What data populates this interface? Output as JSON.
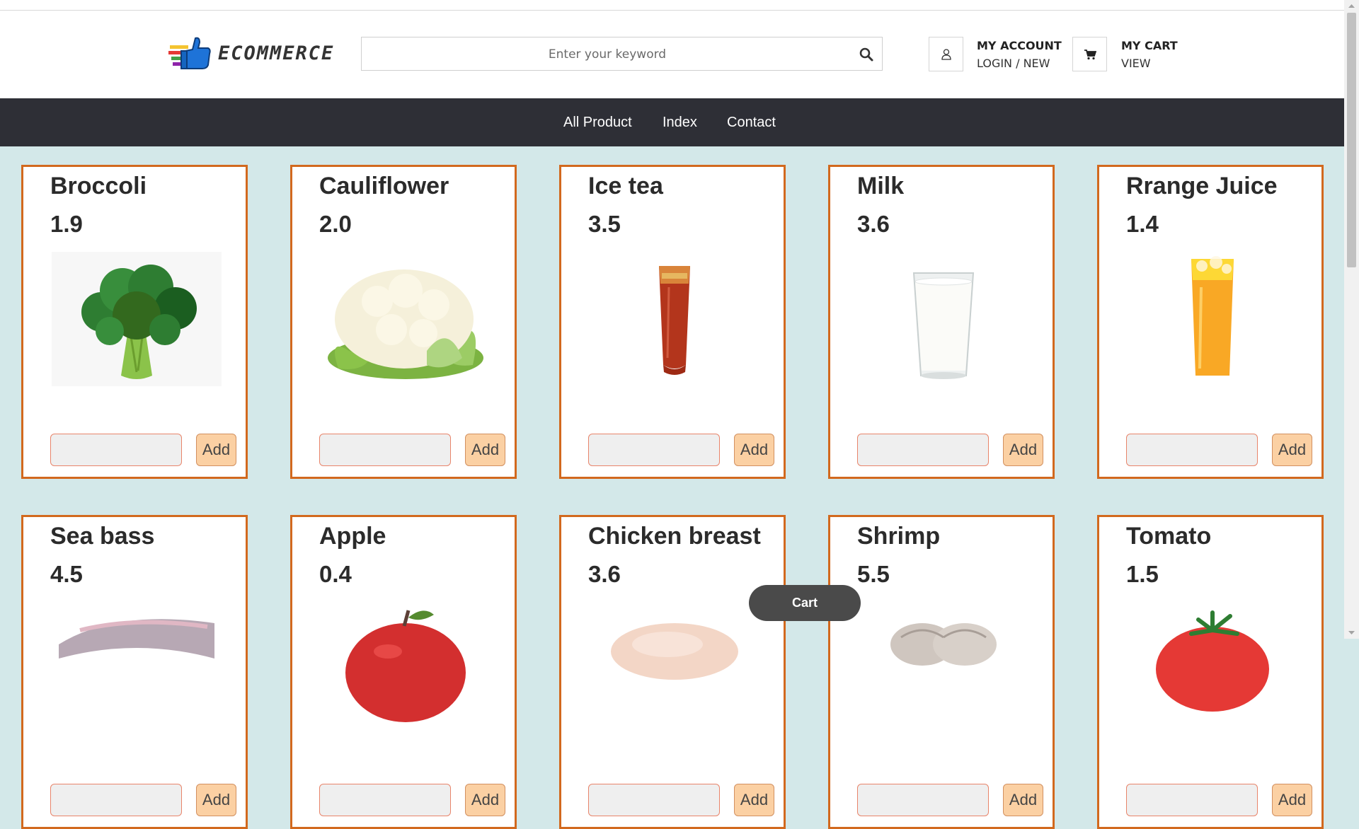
{
  "brand": {
    "name": "ECOMMERCE"
  },
  "search": {
    "placeholder": "Enter your keyword"
  },
  "account": {
    "title": "MY ACCOUNT",
    "link": "LOGIN / NEW"
  },
  "cart": {
    "title": "MY CART",
    "link": "VIEW"
  },
  "nav": {
    "items": [
      "All Product",
      "Index",
      "Contact"
    ]
  },
  "products": [
    {
      "name": "Broccoli",
      "price": "1.9",
      "add_label": "Add",
      "image": "broccoli"
    },
    {
      "name": "Cauliflower",
      "price": "2.0",
      "add_label": "Add",
      "image": "cauliflower"
    },
    {
      "name": "Ice tea",
      "price": "3.5",
      "add_label": "Add",
      "image": "ice-tea"
    },
    {
      "name": "Milk",
      "price": "3.6",
      "add_label": "Add",
      "image": "milk"
    },
    {
      "name": "Rrange Juice",
      "price": "1.4",
      "add_label": "Add",
      "image": "orange-juice"
    },
    {
      "name": "Sea bass",
      "price": "4.5",
      "add_label": "Add",
      "image": "sea-bass"
    },
    {
      "name": "Apple",
      "price": "0.4",
      "add_label": "Add",
      "image": "apple"
    },
    {
      "name": "Chicken breast",
      "price": "3.6",
      "add_label": "Add",
      "image": "chicken-breast"
    },
    {
      "name": "Shrimp",
      "price": "5.5",
      "add_label": "Add",
      "image": "shrimp"
    },
    {
      "name": "Tomato",
      "price": "1.5",
      "add_label": "Add",
      "image": "tomato"
    }
  ],
  "floating_cart": {
    "label": "Cart"
  },
  "colors": {
    "nav_bg": "#2e2f36",
    "page_bg": "#d3e8e9",
    "card_border": "#d2691e",
    "add_bg": "#fbd0a3",
    "cart_button_bg": "#4a4a4a"
  }
}
